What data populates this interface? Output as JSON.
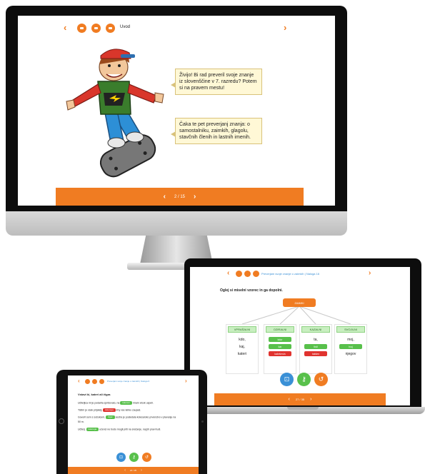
{
  "imac": {
    "title": "Uvod",
    "bubble1": "Živijo! Bi rad preveril svoje znanje iz slovenščine v 7. razredu? Potem si na pravem mestu!",
    "bubble2": "Čaka te pet preverjanj znanja: o samostalniku, zaimkih, glagolu, stavčnih členih in lastnih imenih.",
    "page_indicator": "2 / 15"
  },
  "laptop": {
    "breadcrumb": "Preverjam svoje znanje o zaimkih | Naloga 16",
    "instruction": "Oglej si miselni vzorec in ga dopolni.",
    "root_label": "ZAIMKI",
    "columns": [
      {
        "header": "VPRAŠALNI",
        "words": [
          "kdo,",
          "kaj,",
          "kateri"
        ],
        "pills": []
      },
      {
        "header": "OZIRALNI",
        "words": [],
        "pills": [
          {
            "text": "kdor",
            "color": "green"
          },
          {
            "text": "kar",
            "color": "green"
          },
          {
            "text": "kakršen/a",
            "color": "red"
          }
        ]
      },
      {
        "header": "KAZALNI",
        "words": [
          "ta,"
        ],
        "pills": [
          {
            "text": "tisti",
            "color": "green"
          },
          {
            "text": "takšen",
            "color": "red"
          }
        ]
      },
      {
        "header": "SVOJILNI",
        "words": [
          "moj,",
          "njegov"
        ],
        "pills": [
          {
            "text": "tvoj",
            "color": "green"
          }
        ]
      }
    ],
    "page_indicator": "27 / 35"
  },
  "ipad": {
    "breadcrumb": "Preverjam svoje znanje o zaimkih | Naloga 6",
    "heading": "Vstavi ki, kateri ali čigar.",
    "lines": [
      {
        "pre": "Učiteljica mi je podarila spričevalo, na",
        "pill": "katerem",
        "pill_color": "green",
        "post": "imam visok uspeh."
      },
      {
        "pre": "Tistim je vsak prijatelj,",
        "pill": "katerega",
        "pill_color": "red",
        "post": "imy vse lahko zaupaš."
      },
      {
        "pre": "Govoril sem s sošolcem,",
        "pill": "čigar",
        "pill_color": "green",
        "post": "sestra je posledala kolesarsko prvenstvo v plavanju na"
      },
      {
        "pre": "50 m.",
        "pill": "",
        "pill_color": "",
        "post": ""
      },
      {
        "pre": "Učitelj,",
        "pill": "katerega",
        "pill_color": "green",
        "post": "učenci ne bodo mogli priti na srečanje, naj jih pravi tudi."
      }
    ],
    "page_indicator": "24 / 35"
  },
  "colors": {
    "accent": "#f07c22",
    "green": "#58c04b",
    "red": "#e0332f",
    "blue": "#3a90d6"
  }
}
